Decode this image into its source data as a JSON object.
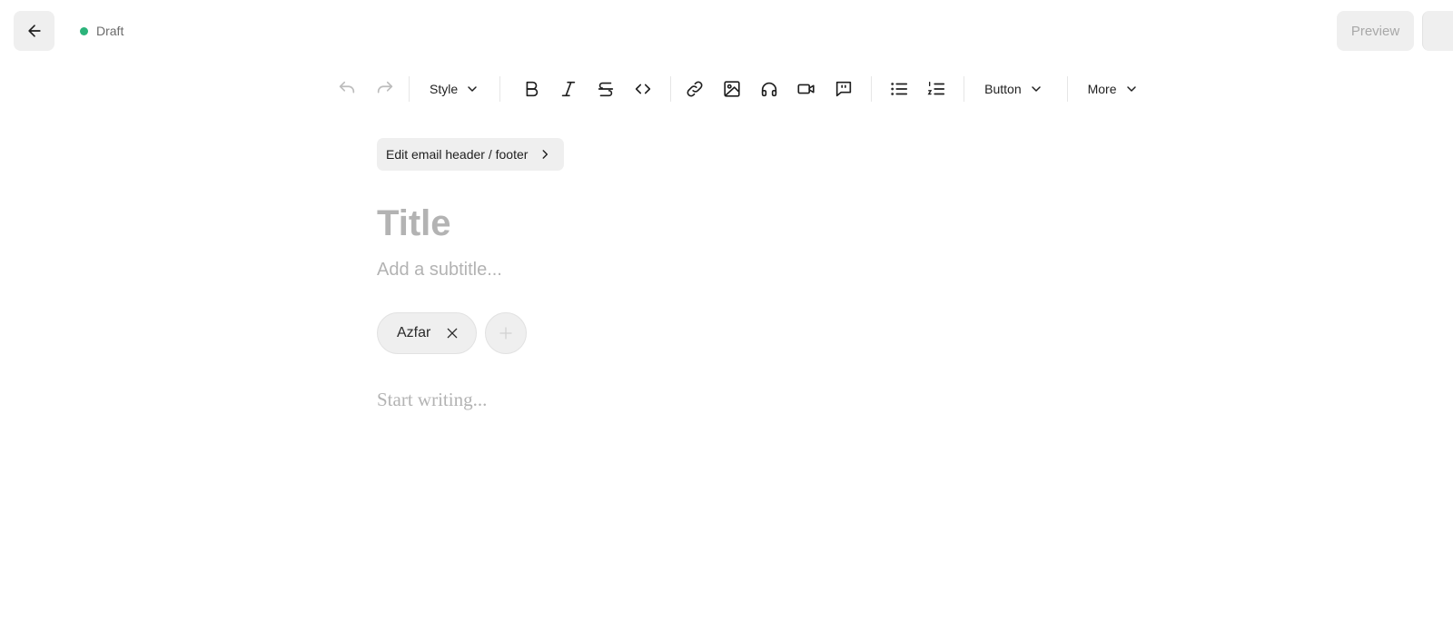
{
  "header": {
    "back_icon": "arrow-left-icon",
    "status": {
      "label": "Draft",
      "color": "#2bb37a"
    },
    "preview_label": "Preview"
  },
  "toolbar": {
    "undo_icon": "undo-icon",
    "redo_icon": "redo-icon",
    "style_label": "Style",
    "formatting": [
      "bold-icon",
      "italic-icon",
      "strikethrough-icon",
      "code-icon"
    ],
    "media": [
      "link-icon",
      "image-icon",
      "audio-icon",
      "video-icon",
      "quote-icon"
    ],
    "lists": [
      "bullet-list-icon",
      "numbered-list-icon"
    ],
    "button_label": "Button",
    "more_label": "More"
  },
  "editor": {
    "header_footer_label": "Edit email header / footer",
    "title_placeholder": "Title",
    "subtitle_placeholder": "Add a subtitle...",
    "authors": [
      "Azfar"
    ],
    "body_placeholder": "Start writing..."
  }
}
